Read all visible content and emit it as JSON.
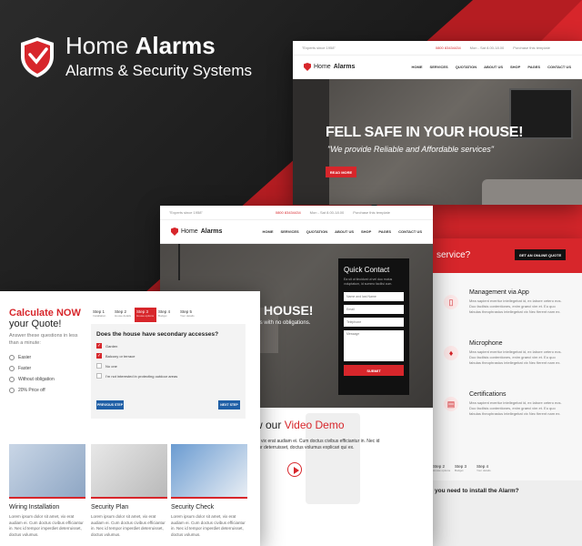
{
  "brand": {
    "name_light": "Home",
    "name_bold": "Alarms",
    "tagline": "Alarms & Security Systems"
  },
  "colors": {
    "accent": "#d7262b",
    "dark": "#1a1a1a",
    "blue": "#1f5fa6"
  },
  "site": {
    "topbar": {
      "experts": "\"Experts since 1958\"",
      "phone": "0800 83434434",
      "hours": "Mon - Sat 8.00-18.00",
      "purchase": "Purchase this template"
    },
    "logo_light": "Home",
    "logo_bold": "Alarms",
    "menu": [
      "HOME",
      "SERVICES",
      "QUOTATION",
      "ABOUT US",
      "SHOP",
      "PAGES",
      "CONTACT US"
    ]
  },
  "hero_a": {
    "title": "FELL SAFE IN YOUR HOUSE!",
    "subtitle": "\"We provide Reliable and Affordable services\"",
    "button": "READ MORE"
  },
  "hero_b": {
    "title": "R HOUSE!",
    "subtitle": "ct us with no obligations."
  },
  "quick_contact": {
    "title": "Quick Contact",
    "desc": "Ea sit ut tincidunt ut vel duo mutus voluptatum, id summo facilisi cum.",
    "fields": [
      "Name and last Name",
      "Email",
      "Telephone"
    ],
    "message": "Message",
    "submit": "SUBMIT"
  },
  "video": {
    "title_pre": "w our",
    "title_accent": "Video Demo",
    "desc": "m, vix erat audiam ei. Cum doctus civibus efficiantur in. Nec id ntur deterruisset, doctus volumus explicari qui ex."
  },
  "services_band": {
    "text": "service?",
    "button": "GET AN ONLINE QUOTE"
  },
  "features": [
    {
      "title": "Management via App",
      "icon": "phone-icon",
      "desc": "Mea sapient everitur intellegebat id, ex labore cetero eos. Duo facilisis contentiones, enim graeci vim et. Eu quo fabulas theophrastus intellegebat vix Nec fierent nam ex."
    },
    {
      "title": "Microphone",
      "icon": "microphone-icon",
      "desc": "Mea sapient everitur intellegebat id, ex labore cetero eos. Duo facilisis contentiones, enim graeci vim et. Eu quo fabulas theophrastus intellegebat vix Nec fierent nam ex."
    },
    {
      "title": "Certifications",
      "icon": "certificate-icon",
      "desc": "Mea sapient everitur intellegebat id, ex labore cetero eos. Duo facilisis contentiones, enim graeci vim et. Eu quo fabulas theophrastus intellegebat vix Nec fierent nam ex."
    }
  ],
  "c_steps": [
    {
      "label": "Step 2",
      "sub": "House options"
    },
    {
      "label": "Step 3",
      "sub": "Budget"
    },
    {
      "label": "Step 4",
      "sub": "Your details"
    }
  ],
  "c_question": "you need to install the Alarm?",
  "calculator": {
    "title_accent": "Calculate NOW",
    "title_rest": "your Quote!",
    "intro": "Answer these questions in less than a minute:",
    "checks": [
      "Easier",
      "Faster",
      "Without obligation",
      "20% Price off"
    ],
    "steps": [
      {
        "label": "Step 1",
        "sub": "Installation"
      },
      {
        "label": "Step 2",
        "sub": "House details"
      },
      {
        "label": "Step 3",
        "sub": "House options"
      },
      {
        "label": "Step 4",
        "sub": "Budget"
      },
      {
        "label": "Step 5",
        "sub": "Your details"
      }
    ],
    "active_step": 3,
    "question": "Does the house have secondary accesses?",
    "options": [
      {
        "label": "Garden",
        "checked": true
      },
      {
        "label": "Balcony or terrace",
        "checked": true
      },
      {
        "label": "No one",
        "checked": false
      },
      {
        "label": "I'm not interested in protecting outdoor areas",
        "checked": false
      }
    ],
    "prev": "PREVIOUS STEP",
    "next": "NEXT STEP"
  },
  "services": [
    {
      "title": "Wiring Installation",
      "desc": "Lorem ipsum dolor sit amet, vix erat audiam ei. Cum doctus civibus efficiantur in. Nec id tempor imperdiet deterruisset, doctus volumus."
    },
    {
      "title": "Security Plan",
      "desc": "Lorem ipsum dolor sit amet, vix erat audiam ei. Cum doctus civibus efficiantur in. Nec id tempor imperdiet deterruisset, doctus volumus."
    },
    {
      "title": "Security Check",
      "desc": "Lorem ipsum dolor sit amet, vix erat audiam ei. Cum doctus civibus efficiantur in. Nec id tempor imperdiet deterruisset, doctus volumus."
    }
  ]
}
